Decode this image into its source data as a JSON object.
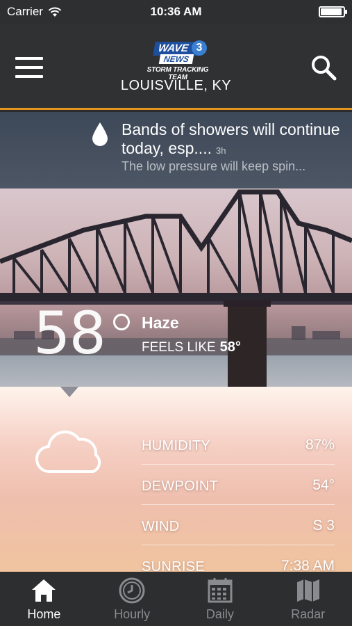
{
  "status_bar": {
    "carrier": "Carrier",
    "time": "10:36 AM",
    "battery_level": 0.95
  },
  "header": {
    "logo": {
      "station": "WAVE",
      "channel": "3",
      "news": "NEWS",
      "team": "STORM TRACKING TEAM"
    },
    "location": "LOUISVILLE, KY",
    "menu_icon": "hamburger-menu-icon",
    "search_icon": "search-icon"
  },
  "alert": {
    "icon": "raindrop-icon",
    "title": "Bands of showers will continue today, esp....",
    "age": "3h",
    "body": "The low pressure will keep spin..."
  },
  "current": {
    "temperature": "58",
    "condition": "Haze",
    "feels_like_label": "FEELS LIKE",
    "feels_like_value": "58°",
    "icon": "cloud-icon"
  },
  "details": [
    {
      "label": "HUMIDITY",
      "value": "87%"
    },
    {
      "label": "DEWPOINT",
      "value": "54°"
    },
    {
      "label": "WIND",
      "value": "S 3"
    },
    {
      "label": "SUNRISE",
      "value": "7:38 AM"
    }
  ],
  "tabs": [
    {
      "label": "Home",
      "icon": "home-icon",
      "active": true
    },
    {
      "label": "Hourly",
      "icon": "clock-icon",
      "active": false
    },
    {
      "label": "Daily",
      "icon": "calendar-icon",
      "active": false
    },
    {
      "label": "Radar",
      "icon": "map-icon",
      "active": false
    }
  ],
  "colors": {
    "accent": "#e3961e",
    "header_bg": "#2f3133",
    "tabbar_bg": "#2d2e30"
  }
}
